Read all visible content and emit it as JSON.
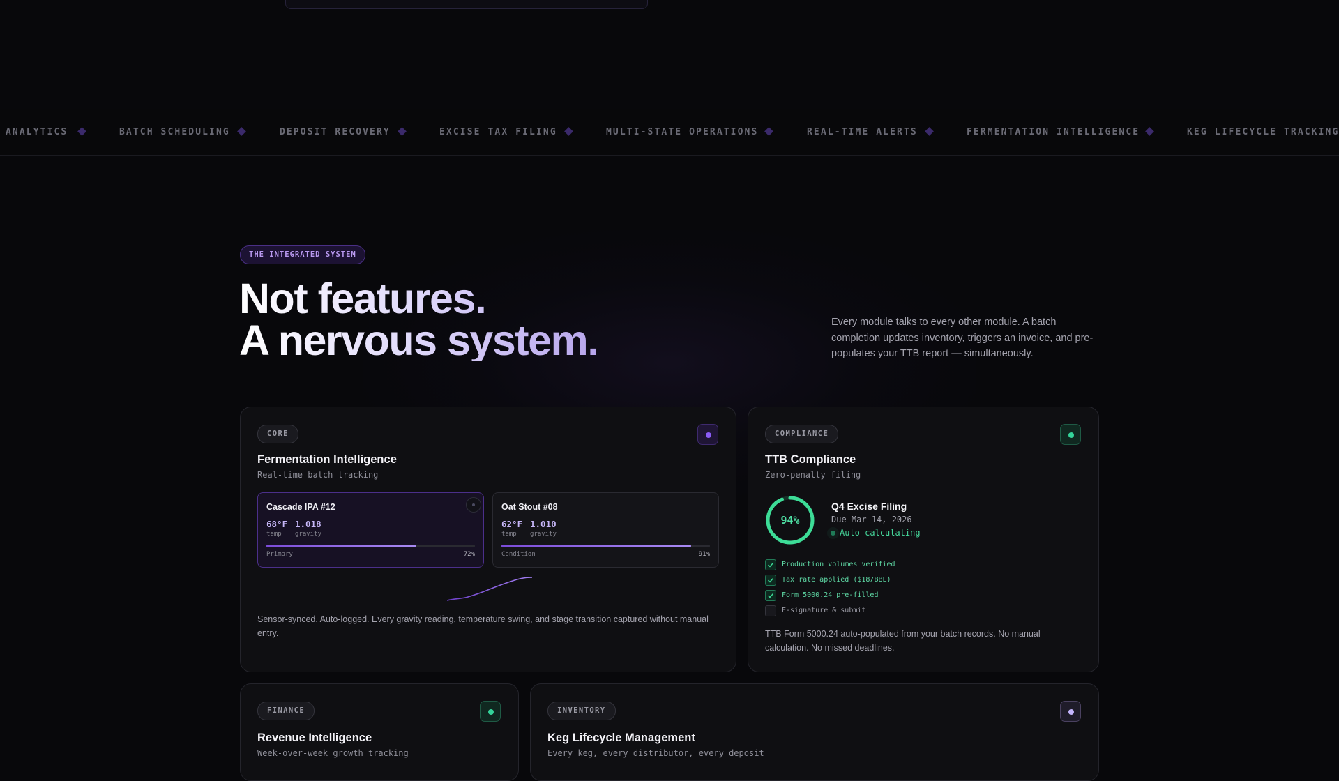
{
  "ticker": {
    "items": [
      "ANALYTICS",
      "BATCH SCHEDULING",
      "DEPOSIT RECOVERY",
      "EXCISE TAX FILING",
      "MULTI-STATE OPERATIONS",
      "REAL-TIME ALERTS",
      "FERMENTATION INTELLIGENCE",
      "KEG LIFECYCLE TRACKING"
    ],
    "separator_icon": "diamond-icon"
  },
  "hero": {
    "eyebrow": "THE INTEGRATED SYSTEM",
    "headline_line1": "Not features.",
    "headline_line2": "A nervous system.",
    "intro": "Every module talks to every other module. A batch completion updates inventory, triggers an invoice, and pre-populates your TTB report — simultaneously."
  },
  "cards": {
    "fermentation": {
      "tag": "CORE",
      "title": "Fermentation Intelligence",
      "subtitle": "Real-time batch tracking",
      "icon": "status-dot-icon",
      "accent": "#8b5cf6",
      "batches": [
        {
          "name": "Cascade IPA #12",
          "temp": "68°F",
          "temp_label": "temp",
          "gravity": "1.018",
          "gravity_label": "gravity",
          "stage": "Primary",
          "progress_label": "72%",
          "progress": 0.72
        },
        {
          "name": "Oat Stout #08",
          "temp": "62°F",
          "temp_label": "temp",
          "gravity": "1.010",
          "gravity_label": "gravity",
          "stage": "Condition",
          "progress_label": "91%",
          "progress": 0.91
        }
      ],
      "description": "Sensor-synced. Auto-logged. Every gravity reading, temperature swing, and stage transition captured without manual entry."
    },
    "compliance": {
      "tag": "COMPLIANCE",
      "title": "TTB Compliance",
      "subtitle": "Zero-penalty filing",
      "icon": "status-dot-icon",
      "accent": "#34d399",
      "progress_label": "94%",
      "progress": 0.94,
      "filing_title": "Q4 Excise Filing",
      "filing_due": "Due Mar 14, 2026",
      "status": "Auto-calculating",
      "checklist": [
        {
          "label": "Production volumes verified",
          "done": true
        },
        {
          "label": "Tax rate applied ($18/BBL)",
          "done": true
        },
        {
          "label": "Form 5000.24 pre-filled",
          "done": true
        },
        {
          "label": "E-signature & submit",
          "done": false
        }
      ],
      "description": "TTB Form 5000.24 auto-populated from your batch records. No manual calculation. No missed deadlines."
    },
    "finance": {
      "tag": "FINANCE",
      "title": "Revenue Intelligence",
      "subtitle": "Week-over-week growth tracking",
      "icon": "status-dot-icon",
      "accent": "#34d399"
    },
    "inventory": {
      "tag": "INVENTORY",
      "title": "Keg Lifecycle Management",
      "subtitle": "Every keg, every distributor, every deposit",
      "icon": "status-dot-icon",
      "accent": "#c4b5fd"
    }
  }
}
